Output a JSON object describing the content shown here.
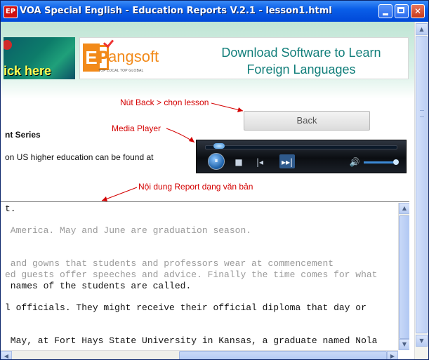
{
  "window": {
    "title": "VOA Special English - Education Reports V.2.1 - lesson1.html",
    "app_icon_text": "EP"
  },
  "banner": {
    "left_text": "ick here",
    "logo_word": "angsoft",
    "logo_letter_e": "E",
    "logo_letter_p": "P",
    "logo_tagline": "TOP LOCAL TOP GLOBAL",
    "right_text": "Download Software to Learn Foreign Languages"
  },
  "annotations": {
    "back": "Nút Back > chọn lesson",
    "media": "Media Player",
    "report": "Nội dung Report dạng văn bản"
  },
  "back_button": {
    "label": "Back"
  },
  "series_title": "nt Series",
  "intro_text": "on US higher education can be found at",
  "player": {
    "play_icon": "⏸",
    "stop_icon": "■",
    "prev_icon": "|◂",
    "next_icon": "▸▸|",
    "volume_icon": "🔊",
    "volume_level_percent": 90,
    "seek_position_percent": 8
  },
  "report": {
    "lines": [
      {
        "text": "t.",
        "tone": "dark"
      },
      {
        "text": " America. May and June are graduation season.",
        "tone": "gray"
      },
      {
        "text": " and gowns that students and professors wear at commencement",
        "tone": "gray"
      },
      {
        "text": "ed guests offer speeches and advice. Finally the time comes for what",
        "tone": "gray"
      },
      {
        "text": " names of the students are called.",
        "tone": "dark"
      },
      {
        "text": "l officials. They might receive their official diploma that day or",
        "tone": "dark"
      },
      {
        "text": " May, at Fort Hays State University in Kansas, a graduate named Nola",
        "tone": "dark"
      }
    ]
  },
  "colors": {
    "titlebar": "#0a5ee8",
    "banner_text": "#117e7a",
    "logo_orange": "#f28a1a",
    "annotation_red": "#d40000"
  }
}
